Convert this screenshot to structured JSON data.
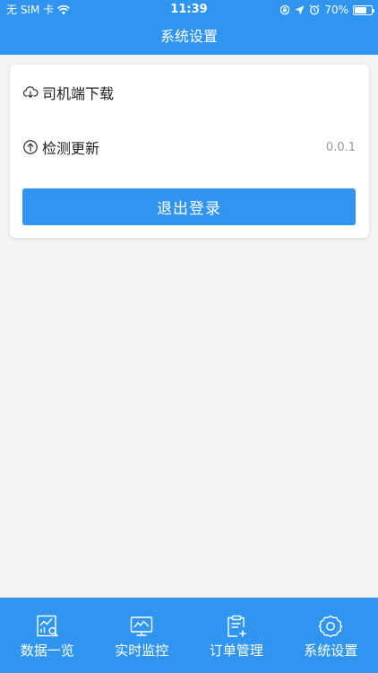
{
  "status_bar": {
    "carrier": "无 SIM 卡",
    "time": "11:39",
    "battery": "70%",
    "battery_level": 0.7
  },
  "header": {
    "title": "系统设置"
  },
  "settings": {
    "download_label": "司机端下载",
    "update_label": "检测更新",
    "version": "0.0.1",
    "logout_label": "退出登录"
  },
  "tabbar": {
    "tabs": [
      {
        "label": "数据一览",
        "icon": "data-overview-icon"
      },
      {
        "label": "实时监控",
        "icon": "monitor-icon"
      },
      {
        "label": "订单管理",
        "icon": "order-icon"
      },
      {
        "label": "系统设置",
        "icon": "settings-gear-icon"
      }
    ]
  },
  "colors": {
    "primary": "#2f95f0",
    "background": "#f4f4f4",
    "muted": "#999999"
  }
}
